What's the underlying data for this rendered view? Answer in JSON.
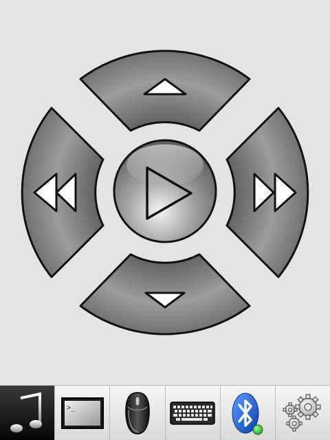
{
  "dpad": {
    "buttons": [
      {
        "id": "up",
        "icon": "triangle-up-icon"
      },
      {
        "id": "left",
        "icon": "rewind-icon"
      },
      {
        "id": "center",
        "icon": "play-icon"
      },
      {
        "id": "right",
        "icon": "fast-forward-icon"
      },
      {
        "id": "down",
        "icon": "triangle-down-icon"
      }
    ]
  },
  "tabbar": {
    "active_tab": "music",
    "tabs": [
      {
        "id": "music",
        "icon": "music-note-icon"
      },
      {
        "id": "terminal",
        "icon": "terminal-icon",
        "prompt_text": ">_"
      },
      {
        "id": "mouse",
        "icon": "mouse-icon"
      },
      {
        "id": "keyboard",
        "icon": "keyboard-icon"
      },
      {
        "id": "bluetooth",
        "icon": "bluetooth-icon",
        "status_color": "#2fb52f"
      },
      {
        "id": "settings",
        "icon": "gears-icon"
      }
    ]
  },
  "colors": {
    "background": "#e4e4e4",
    "button_fill": "#8a8a8a",
    "button_stroke": "#111111",
    "bluetooth_blue": "#1f5fd6",
    "status_green": "#2fb52f"
  }
}
